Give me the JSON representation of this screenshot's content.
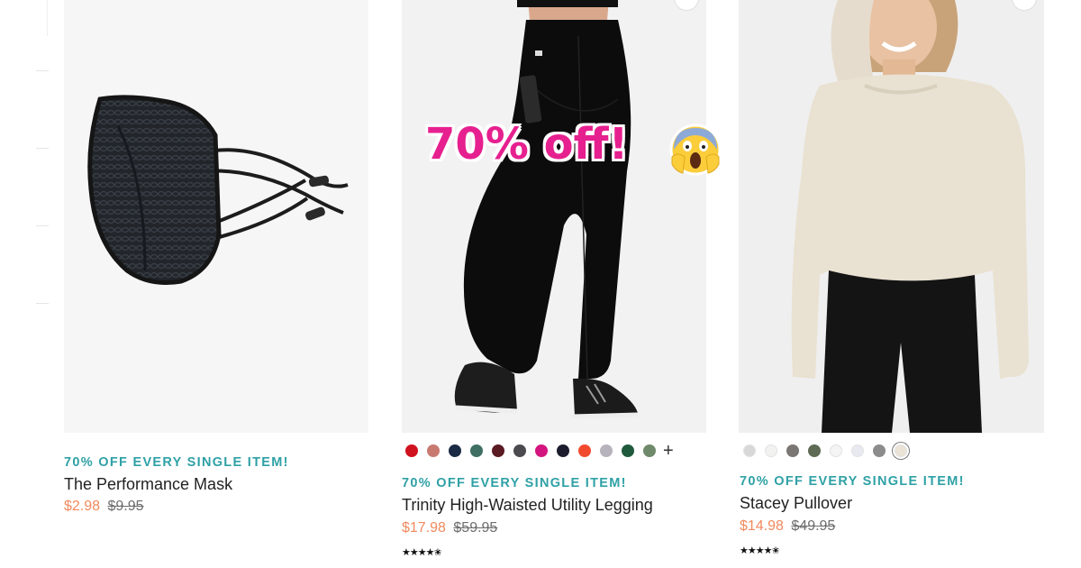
{
  "overlay": {
    "text": "70% off!",
    "emoji": "face-screaming-in-fear"
  },
  "products": [
    {
      "promo": "70% OFF EVERY SINGLE ITEM!",
      "name": "The Performance Mask",
      "sale_price": "$2.98",
      "original_price": "$9.95",
      "swatches": [],
      "rating": null
    },
    {
      "promo": "70% OFF EVERY SINGLE ITEM!",
      "name": "Trinity High-Waisted Utility Legging",
      "sale_price": "$17.98",
      "original_price": "$59.95",
      "swatches": [
        "#d0121f",
        "#c97a70",
        "#1b2a45",
        "#3f6f63",
        "#5a1b22",
        "#4b4b4f",
        "#d4157f",
        "#1c1c2e",
        "#f14a2e",
        "#b7b3bc",
        "#1f5a3c",
        "#6f8a6a"
      ],
      "more_colors": "+",
      "rating": 4.5,
      "rating_stars": "★★★★✬"
    },
    {
      "promo": "70% OFF EVERY SINGLE ITEM!",
      "name": "Stacey Pullover",
      "sale_price": "$14.98",
      "original_price": "$49.95",
      "swatches": [
        "#d8d8d8",
        "#f2f2f0",
        "#7a7673",
        "#5f6b55",
        "#f4f4f4",
        "#e9e9f2",
        "#8c8c8c",
        "#eae3d6"
      ],
      "rating": 4.5,
      "rating_stars": "★★★★✬"
    }
  ]
}
